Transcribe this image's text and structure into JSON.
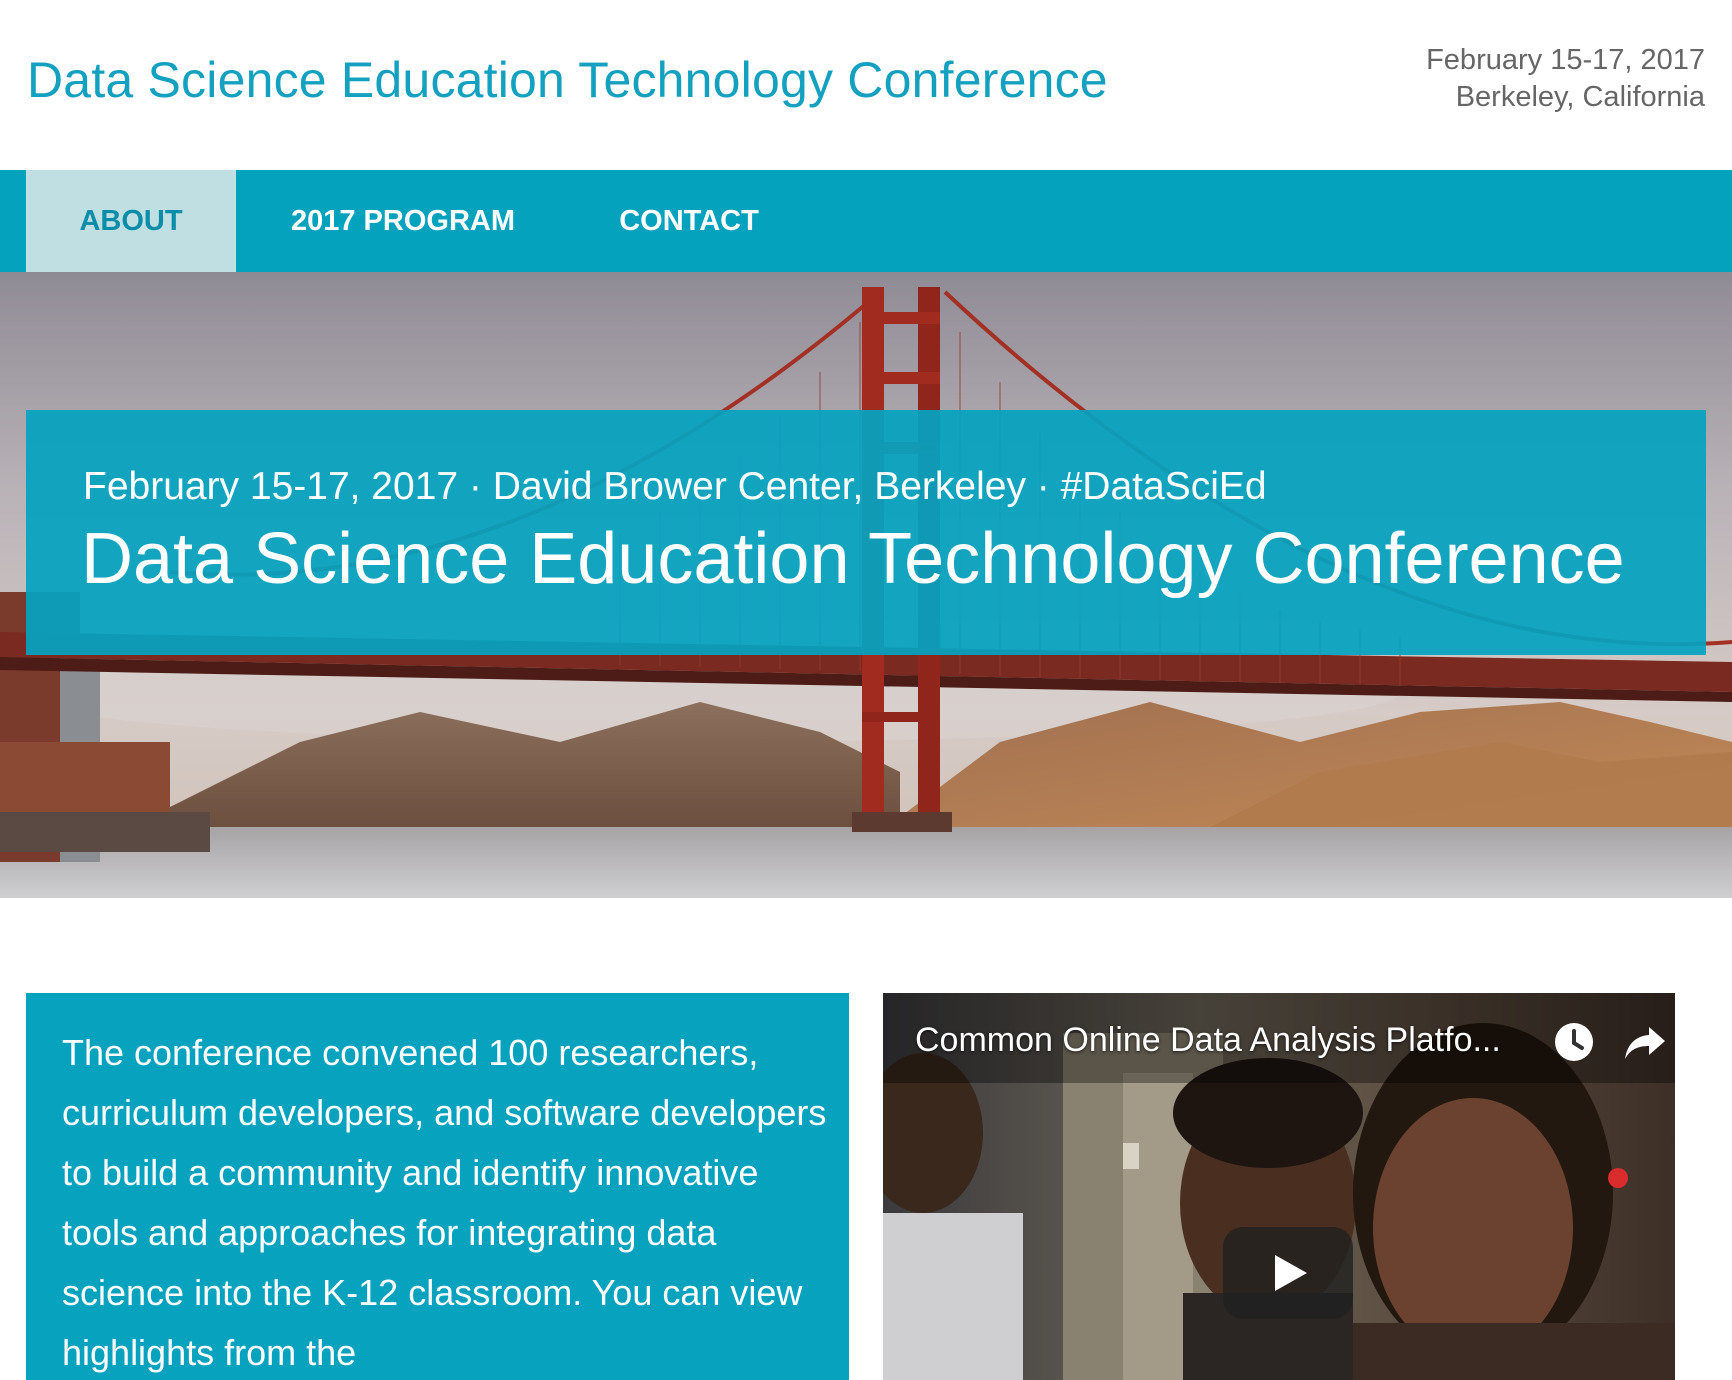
{
  "header": {
    "title": "Data Science Education Technology Conference",
    "dates": "February 15-17, 2017",
    "location": "Berkeley, California"
  },
  "nav": {
    "items": [
      {
        "label": "ABOUT",
        "active": true
      },
      {
        "label": "2017 PROGRAM",
        "active": false
      },
      {
        "label": "CONTACT",
        "active": false
      }
    ]
  },
  "hero": {
    "subtitle": "February 15-17, 2017 · David Brower Center, Berkeley · #DataSciEd",
    "title": "Data Science Education Technology Conference",
    "image": "golden-gate-bridge-photo"
  },
  "intro": {
    "text": "The conference convened 100 researchers, curriculum developers, and software developers to build a community and identify innovative tools and approaches for integrating data science into the K-12 classroom. You can view highlights from the"
  },
  "video": {
    "title": "Common Online Data Analysis Platfo...",
    "icons": {
      "watch_later": "clock-icon",
      "share": "share-arrow-icon",
      "play": "play-icon"
    }
  },
  "colors": {
    "brand": "#05a2be",
    "nav_active_bg": "#bfdfe2",
    "nav_active_text": "#0a8da8",
    "title": "#14a1bf",
    "meta_text": "#666666"
  }
}
